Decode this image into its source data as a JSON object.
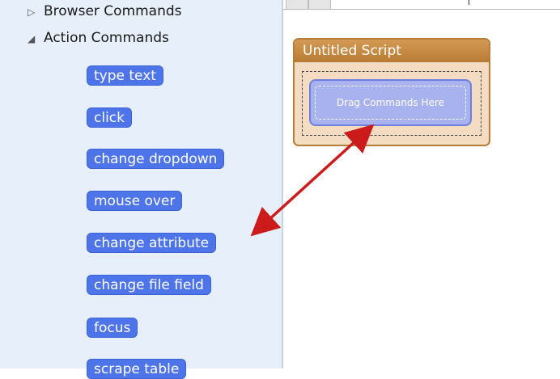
{
  "sidebar": {
    "tree": [
      {
        "label": "Browser Commands",
        "expanded": false
      },
      {
        "label": "Action Commands",
        "expanded": true
      }
    ],
    "commands": [
      "type text",
      "click",
      "change dropdown",
      "mouse over",
      "change attribute",
      "change file field",
      "focus",
      "scrape table"
    ]
  },
  "script": {
    "title": "Untitled Script",
    "drop_placeholder": "Drag Commands Here"
  },
  "colors": {
    "command_bg": "#4d74e8",
    "script_header": "#c08540",
    "arrow": "#cc1b1b"
  }
}
